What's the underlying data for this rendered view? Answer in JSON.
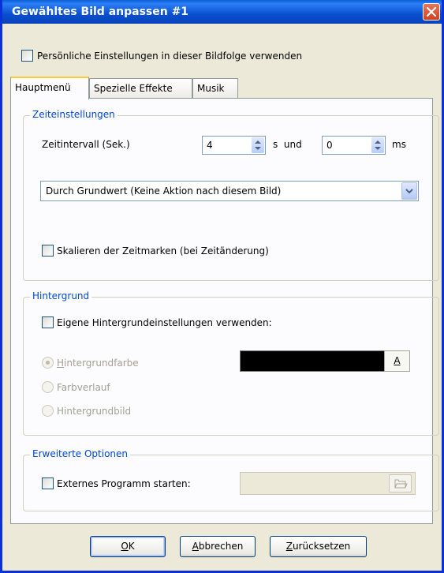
{
  "window": {
    "title": "Gewähltes Bild anpassen #1"
  },
  "personal_settings": {
    "label": "Persönliche Einstellungen in dieser Bildfolge verwenden",
    "checked": false
  },
  "tabs": [
    {
      "label": "Hauptmenü",
      "active": true
    },
    {
      "label": "Spezielle Effekte",
      "active": false
    },
    {
      "label": "Musik",
      "active": false
    }
  ],
  "time_settings": {
    "legend": "Zeiteinstellungen",
    "interval_label": "Zeitintervall (Sek.)",
    "seconds_value": "4",
    "seconds_unit": "s  und",
    "ms_value": "0",
    "ms_unit": "ms",
    "action_dropdown": "Durch Grundwert (Keine Aktion nach diesem Bild)",
    "scale_label": "Skalieren der Zeitmarken (bei Zeitänderung)",
    "scale_checked": false
  },
  "background": {
    "legend": "Hintergrund",
    "own_settings_label": "Eigene Hintergrundeinstellungen verwenden:",
    "own_settings_checked": false,
    "options": [
      {
        "label": "Hintergrundfarbe",
        "mnemonic": "H",
        "rest": "intergrundfarbe",
        "selected": true
      },
      {
        "label": "Farbverlauf",
        "selected": false
      },
      {
        "label": "Hintergrundbild",
        "selected": false
      }
    ],
    "color_value": "#000000",
    "color_button_label": "A"
  },
  "advanced": {
    "legend": "Erweiterte Optionen",
    "external_program_label": "Externes Programm starten:",
    "external_program_checked": false,
    "path_value": ""
  },
  "buttons": {
    "ok": {
      "mnemonic": "O",
      "rest": "K"
    },
    "cancel": {
      "mnemonic": "A",
      "rest": "bbrechen"
    },
    "reset": {
      "mnemonic": "Z",
      "rest": "urücksetzen"
    }
  },
  "colors": {
    "titlebar": "#0a4fd1",
    "accent_legend": "#0046d5",
    "dialog_bg": "#ece9d8"
  }
}
